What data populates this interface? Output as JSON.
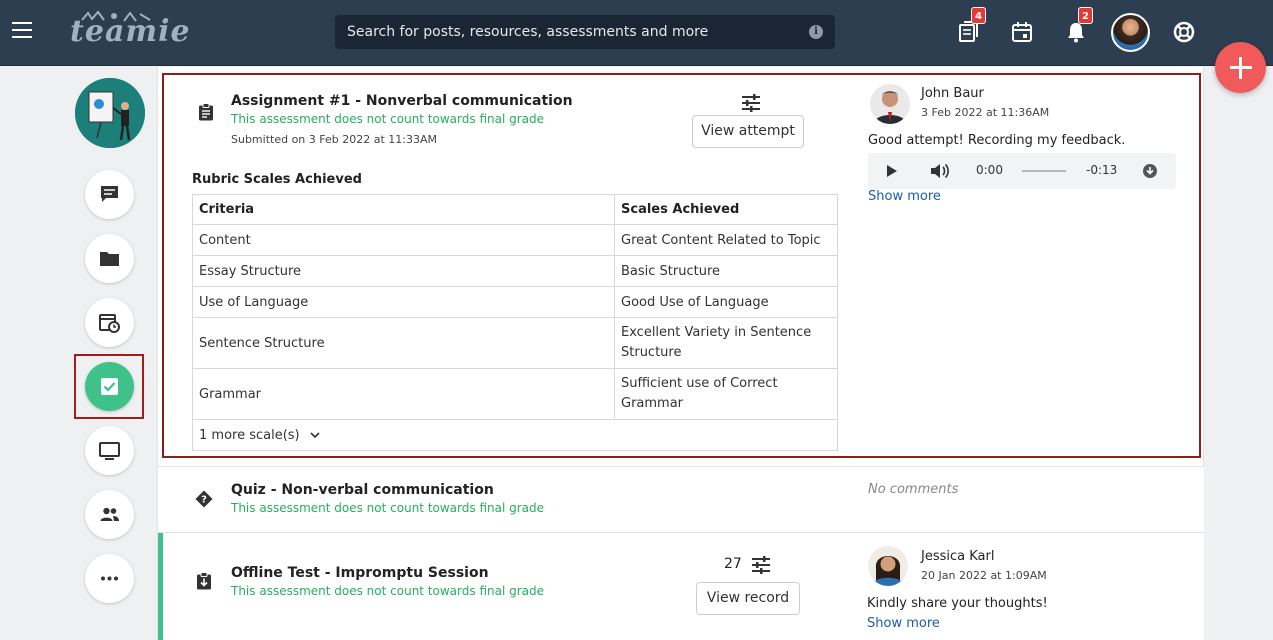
{
  "search": {
    "placeholder": "Search for posts, resources, assessments and more"
  },
  "topbar": {
    "logo_text": "teamie",
    "badges": {
      "newsfeed": "4",
      "notifications": "2"
    }
  },
  "assessments": [
    {
      "title": "Assignment #1 - Nonverbal communication",
      "note": "This assessment does not count towards final grade",
      "submitted": "Submitted on 3 Feb 2022 at 11:33AM",
      "action_label": "View attempt",
      "rubric": {
        "heading": "Rubric Scales Achieved",
        "columns": [
          "Criteria",
          "Scales Achieved"
        ],
        "rows": [
          [
            "Content",
            "Great Content Related to Topic"
          ],
          [
            "Essay Structure",
            "Basic Structure"
          ],
          [
            "Use of Language",
            "Good Use of Language"
          ],
          [
            "Sentence Structure",
            "Excellent Variety in Sentence Structure"
          ],
          [
            "Grammar",
            "Sufficient use of Correct Grammar"
          ]
        ],
        "more_label": "1 more scale(s)"
      },
      "comment": {
        "author": "John Baur",
        "date": "3 Feb 2022 at 11:36AM",
        "text": "Good attempt! Recording my feedback.",
        "audio": {
          "current": "0:00",
          "remaining": "-0:13"
        },
        "show_more": "Show more"
      }
    },
    {
      "title": "Quiz - Non-verbal communication",
      "note": "This assessment does not count towards final grade",
      "no_comments": "No comments"
    },
    {
      "title": "Offline Test - Impromptu Session",
      "note": "This assessment does not count towards final grade",
      "score": "27",
      "action_label": "View record",
      "comment": {
        "author": "Jessica Karl",
        "date": "20 Jan 2022 at 1:09AM",
        "text": "Kindly share your thoughts!",
        "show_more": "Show more"
      }
    }
  ],
  "colors": {
    "topbar": "#2c3e50",
    "accent_green": "#3ec28a",
    "note_green": "#27ae60",
    "highlight_border": "#8f1d1d",
    "fab": "#f15a5a",
    "badge": "#e53935"
  }
}
